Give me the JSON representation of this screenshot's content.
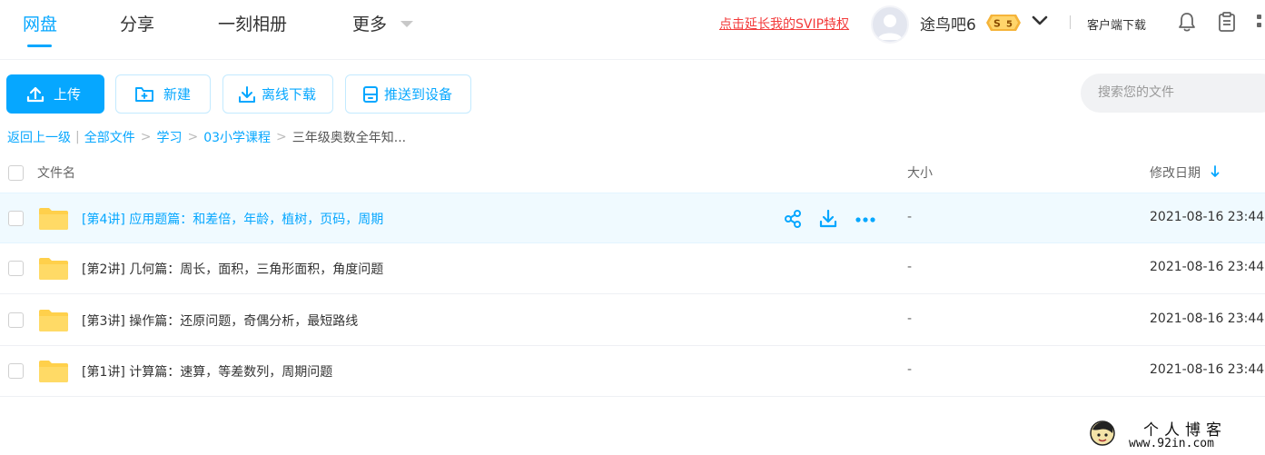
{
  "nav": {
    "tabs": [
      {
        "label": "网盘",
        "active": true
      },
      {
        "label": "分享",
        "active": false
      },
      {
        "label": "一刻相册",
        "active": false
      },
      {
        "label": "更多",
        "active": false
      }
    ],
    "svip_link": "点击延长我的SVIP特权",
    "username": "途鸟吧6",
    "vip_level": "5",
    "client_download": "客户端下载"
  },
  "toolbar": {
    "upload": "上传",
    "new": "新建",
    "offline_download": "离线下载",
    "push_to_device": "推送到设备",
    "search_placeholder": "搜索您的文件"
  },
  "breadcrumb": {
    "back": "返回上一级",
    "items": [
      "全部文件",
      "学习",
      "03小学课程"
    ],
    "current": "三年级奥数全年知..."
  },
  "table": {
    "columns": {
      "name": "文件名",
      "size": "大小",
      "modified": "修改日期"
    },
    "sort": {
      "column": "modified",
      "direction": "desc"
    },
    "rows": [
      {
        "name": "[第4讲] 应用题篇：和差倍，年龄，植树，页码，周期",
        "size": "-",
        "modified": "2021-08-16 23:44",
        "hovered": true
      },
      {
        "name": "[第2讲] 几何篇：周长，面积，三角形面积，角度问题",
        "size": "-",
        "modified": "2021-08-16 23:44",
        "hovered": false
      },
      {
        "name": "[第3讲] 操作篇：还原问题，奇偶分析，最短路线",
        "size": "-",
        "modified": "2021-08-16 23:44",
        "hovered": false
      },
      {
        "name": "[第1讲] 计算篇：速算，等差数列，周期问题",
        "size": "-",
        "modified": "2021-08-16 23:44",
        "hovered": false
      }
    ]
  },
  "watermark": {
    "title": "个人博客",
    "url": "www.92in.com"
  },
  "colors": {
    "accent": "#06a7ff",
    "svip_red": "#f33b3b",
    "folder_yellow": "#ffd04b",
    "hover_row_bg": "#f0faff",
    "vip_gold": "#f5b43a"
  },
  "icons": {
    "upload": "upload-icon",
    "new": "new-folder-icon",
    "offline_download": "download-icon",
    "push_to_device": "device-icon",
    "share": "share-icon",
    "download": "download-icon",
    "more": "more-dots-icon",
    "notifications": "bell-icon",
    "tasks": "clipboard-icon",
    "apps": "grid-icon",
    "sort": "arrow-down-icon",
    "folder": "folder-icon"
  }
}
